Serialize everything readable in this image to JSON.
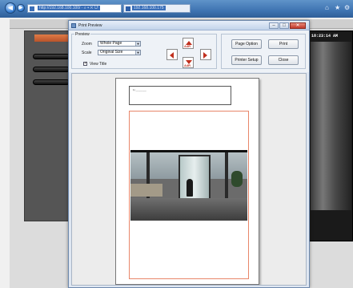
{
  "browser": {
    "address_text": "http://192.168.100.100/ · ⌕ ▾ ✕ ⟳",
    "tab_title": "192.168.100.175",
    "nav_back_glyph": "◀",
    "nav_forward_glyph": "▶",
    "icons": [
      "home-icon",
      "favorites-icon",
      "settings-icon"
    ]
  },
  "app": {
    "sidebar_buttons": [
      "",
      "",
      ""
    ],
    "camera_time": "18:23:14 AM"
  },
  "dialog": {
    "title": "Print Preview",
    "window_controls": {
      "minimize": "–",
      "maximize": "□",
      "close": "✕"
    },
    "preview_group_label": "Preview",
    "zoom_label": "Zoom",
    "zoom_value": "Whole Page",
    "scale_label": "Scale",
    "scale_value": "Original Size",
    "view_title_label": "View Title",
    "view_title_checked": true,
    "page_option_label": "Page Option",
    "print_label": "Print",
    "printer_setup_label": "Printer Setup",
    "close_label": "Close",
    "arrow_labels": {
      "up": "A4R",
      "down": "A4R"
    }
  },
  "paper": {
    "title_line": "1)    ________"
  }
}
